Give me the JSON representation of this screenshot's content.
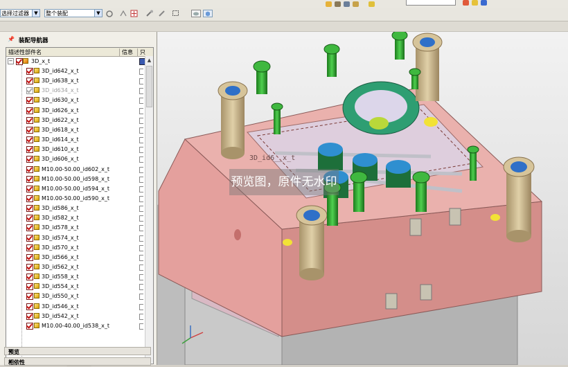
{
  "toolbar": {
    "filter_select": "选择过滤器",
    "scope_select": "整个装配"
  },
  "navigator": {
    "title": "装配导航器",
    "columns": {
      "name": "描述性部件名",
      "info": "信息",
      "readonly": "只"
    },
    "root": "3D_x_t",
    "items": [
      {
        "label": "3D_id642_x_t",
        "checked": true
      },
      {
        "label": "3D_id638_x_t",
        "checked": true
      },
      {
        "label": "3D_id634_x_t",
        "checked": false
      },
      {
        "label": "3D_id630_x_t",
        "checked": true
      },
      {
        "label": "3D_id626_x_t",
        "checked": true
      },
      {
        "label": "3D_id622_x_t",
        "checked": true
      },
      {
        "label": "3D_id618_x_t",
        "checked": true
      },
      {
        "label": "3D_id614_x_t",
        "checked": true
      },
      {
        "label": "3D_id610_x_t",
        "checked": true
      },
      {
        "label": "3D_id606_x_t",
        "checked": true
      },
      {
        "label": "M10.00-50.00_id602_x_t",
        "checked": true
      },
      {
        "label": "M10.00-50.00_id598_x_t",
        "checked": true
      },
      {
        "label": "M10.00-50.00_id594_x_t",
        "checked": true
      },
      {
        "label": "M10.00-50.00_id590_x_t",
        "checked": true
      },
      {
        "label": "3D_id586_x_t",
        "checked": true
      },
      {
        "label": "3D_id582_x_t",
        "checked": true
      },
      {
        "label": "3D_id578_x_t",
        "checked": true
      },
      {
        "label": "3D_id574_x_t",
        "checked": true
      },
      {
        "label": "3D_id570_x_t",
        "checked": true
      },
      {
        "label": "3D_id566_x_t",
        "checked": true
      },
      {
        "label": "3D_id562_x_t",
        "checked": true
      },
      {
        "label": "3D_id558_x_t",
        "checked": true
      },
      {
        "label": "3D_id554_x_t",
        "checked": true
      },
      {
        "label": "3D_id550_x_t",
        "checked": true
      },
      {
        "label": "3D_id546_x_t",
        "checked": true
      },
      {
        "label": "3D_id542_x_t",
        "checked": true
      },
      {
        "label": "M10.00-40.00_id538_x_t",
        "checked": true
      }
    ],
    "preview_panel": "预览",
    "dependency_panel": "相依性"
  },
  "viewport": {
    "watermark": "预览图，原件无水印",
    "part_label": "3D_id6__x_t"
  },
  "colors": {
    "mold_plate": "#e8a7a3",
    "leader_pin": "#c9b48a",
    "screw": "#2ea82e",
    "frame": "#bfbfbf",
    "background": "#e4e4e4"
  }
}
